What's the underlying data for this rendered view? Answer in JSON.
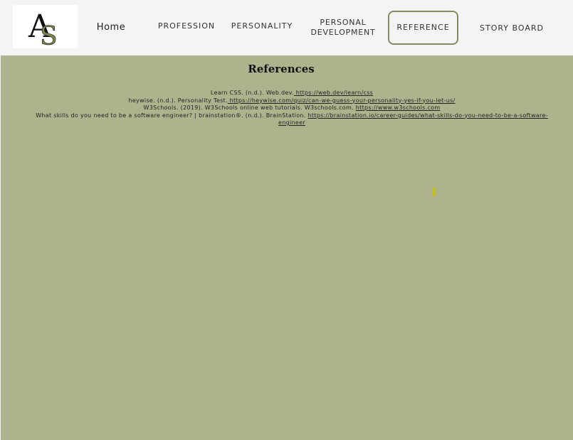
{
  "nav": {
    "home": "Home",
    "profession": "PROFESSION",
    "personality": "PERSONALITY",
    "personal_line1": "PERSONAL",
    "personal_line2": "DEVELOPMENT",
    "reference": "REFERENCE",
    "storyboard": "STORY BOARD"
  },
  "logo": {
    "letter_a": "A",
    "letter_s": "S"
  },
  "main": {
    "title": "References",
    "refs": [
      {
        "text": "Learn CSS. (n.d.). Web.dev.",
        "link": " https://web.dev/learn/css"
      },
      {
        "text": "heywise. (n.d.). Personality Test.",
        "link": " https://heywise.com/quiz/can-we-guess-your-personality-yes-if-you-let-us/"
      },
      {
        "text": "W3Schools. (2019). W3Schools online web tutorials. W3schools.com.",
        "link": "https://www.w3schools.com "
      },
      {
        "text": "What skills do you need to be a software engineer? | brainstation®. (n.d.). BrainStation.",
        "link": "https://brainstation.io/career-guides/what-skills-do-you-need-to-be-a-software-engineer"
      }
    ]
  },
  "colors": {
    "header_bg": "#f4f4f4",
    "main_bg": "#aeb38e",
    "accent_border": "#858b5b",
    "logo_s": "#7d8451"
  }
}
